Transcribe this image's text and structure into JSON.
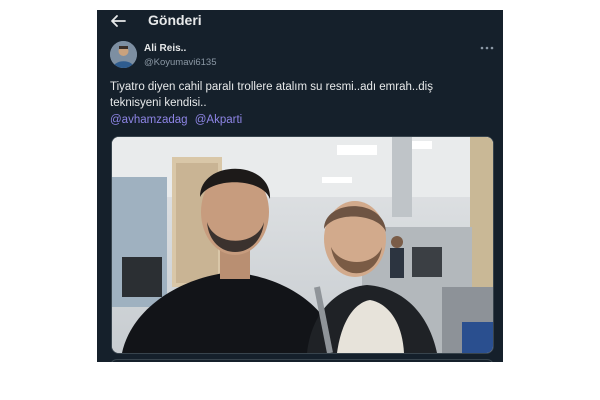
{
  "header": {
    "title": "Gönderi",
    "back_icon": "arrow-left-icon"
  },
  "tweet": {
    "author": {
      "display_name": "Ali Reis..",
      "handle": "@Koyumavi6135"
    },
    "more_icon": "more-horizontal-icon",
    "text_lines": [
      "Tiyatro diyen cahil paralı trollere atalım su resmi..adı emrah..diş",
      "teknisyeni kendisi.."
    ],
    "mentions": [
      "@avhamzadag",
      "@Akparti"
    ],
    "media": {
      "description_icon": "photo"
    }
  },
  "colors": {
    "background": "#15202b",
    "text": "#e7e9ea",
    "secondary_text": "#8b98a5",
    "mention": "#8e85e6",
    "border": "#38444d"
  }
}
